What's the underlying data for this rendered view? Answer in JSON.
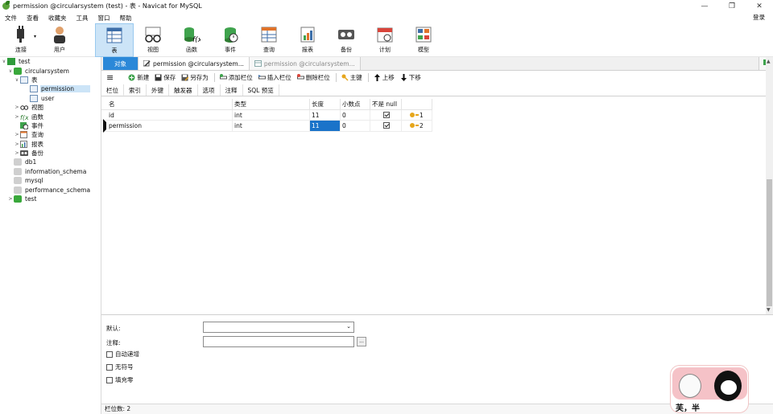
{
  "window": {
    "title": "permission @circularsystem (test) - 表 - Navicat for MySQL",
    "minimize": "—",
    "restore": "❐",
    "close": "✕"
  },
  "menu": {
    "items": [
      "文件",
      "查看",
      "收藏夹",
      "工具",
      "窗口",
      "帮助"
    ],
    "login": "登录"
  },
  "toolbar": {
    "items": [
      {
        "label": "连接",
        "icon": "plug-icon"
      },
      {
        "label": "用户",
        "icon": "user-icon"
      },
      {
        "label": "表",
        "icon": "table-icon"
      },
      {
        "label": "视图",
        "icon": "glasses-icon"
      },
      {
        "label": "函数",
        "icon": "function-icon"
      },
      {
        "label": "事件",
        "icon": "event-icon"
      },
      {
        "label": "查询",
        "icon": "query-icon"
      },
      {
        "label": "报表",
        "icon": "report-icon"
      },
      {
        "label": "备份",
        "icon": "backup-icon"
      },
      {
        "label": "计划",
        "icon": "calendar-icon"
      },
      {
        "label": "模型",
        "icon": "model-icon"
      }
    ]
  },
  "tree": [
    {
      "label": "test",
      "level": 0,
      "arrow": "∨"
    },
    {
      "label": "circularsystem",
      "level": 1,
      "arrow": "∨"
    },
    {
      "label": "表",
      "level": 2,
      "arrow": "∨"
    },
    {
      "label": "permission",
      "level": 3,
      "arrow": "",
      "selected": true
    },
    {
      "label": "user",
      "level": 3,
      "arrow": ""
    },
    {
      "label": "视图",
      "level": 2,
      "arrow": ">"
    },
    {
      "label": "函数",
      "level": 2,
      "arrow": ">"
    },
    {
      "label": "事件",
      "level": 2,
      "arrow": ""
    },
    {
      "label": "查询",
      "level": 2,
      "arrow": ">"
    },
    {
      "label": "报表",
      "level": 2,
      "arrow": ">"
    },
    {
      "label": "备份",
      "level": 2,
      "arrow": ">"
    },
    {
      "label": "db1",
      "level": 1,
      "arrow": ""
    },
    {
      "label": "information_schema",
      "level": 1,
      "arrow": ""
    },
    {
      "label": "mysql",
      "level": 1,
      "arrow": ""
    },
    {
      "label": "performance_schema",
      "level": 1,
      "arrow": ""
    },
    {
      "label": "test",
      "level": 1,
      "arrow": ">"
    }
  ],
  "tabs": {
    "object": "对象",
    "tab1": "permission @circularsystem...",
    "tab2": "permission @circularsystem..."
  },
  "editor_toolbar": {
    "menu": "≡",
    "new": "新建",
    "save": "保存",
    "save_as": "另存为",
    "add_field": "添加栏位",
    "insert_field": "插入栏位",
    "delete_field": "删除栏位",
    "primary_key": "主键",
    "move_up": "上移",
    "move_down": "下移"
  },
  "subtabs": [
    "栏位",
    "索引",
    "外键",
    "触发器",
    "选项",
    "注释",
    "SQL 预览"
  ],
  "grid": {
    "headers": [
      "名",
      "类型",
      "长度",
      "小数点",
      "不是 null",
      ""
    ],
    "rows": [
      {
        "name": "id",
        "type": "int",
        "length": "11",
        "decimals": "0",
        "not_null": true,
        "key": "1"
      },
      {
        "name": "permission",
        "type": "int",
        "length": "11",
        "decimals": "0",
        "not_null": true,
        "key": "2"
      }
    ]
  },
  "props": {
    "default_label": "默认:",
    "comment_label": "注释:",
    "auto_increment": "自动递增",
    "unsigned": "无符号",
    "zerofill": "填充零"
  },
  "status": {
    "field_count": "栏位数: 2"
  },
  "sticker": {
    "text": "芙，半 "
  }
}
